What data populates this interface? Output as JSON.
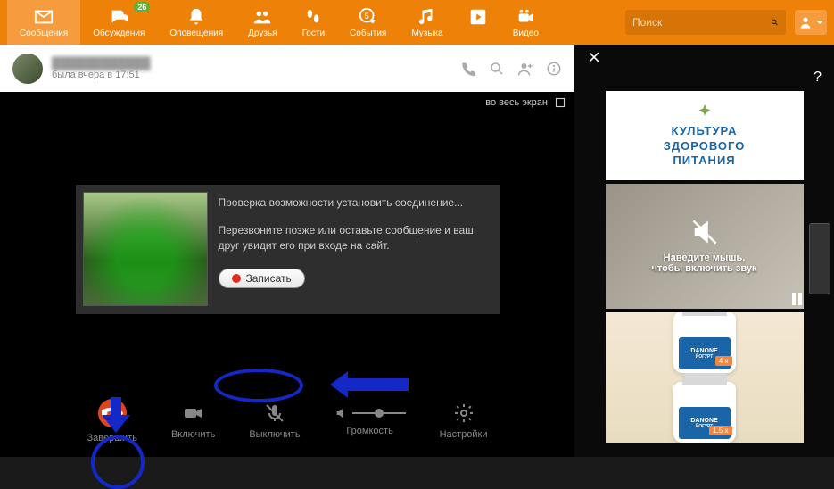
{
  "nav": {
    "messages": "Сообщения",
    "discussions": "Обсуждения",
    "discussions_badge": "26",
    "notifications": "Оповещения",
    "friends": "Друзья",
    "guests": "Гости",
    "events": "События",
    "music": "Музыка",
    "video": "Видео"
  },
  "search": {
    "placeholder": "Поиск"
  },
  "chat": {
    "name": "████████████",
    "status": "была вчера в 17:51"
  },
  "fullscreen_label": "во весь экран",
  "call": {
    "checking": "Проверка возможности установить соединение...",
    "callback": "Перезвоните позже или оставьте сообщение и ваш друг увидит его при входе на сайт.",
    "record": "Записать"
  },
  "controls": {
    "end": "Завершить",
    "video_on": "Включить",
    "mic_off": "Выключить",
    "volume": "Громкость",
    "settings": "Настройки"
  },
  "side": {
    "help": "?"
  },
  "ads": {
    "ad1_line1": "КУЛЬТУРА",
    "ad1_line2": "ЗДОРОВОГО",
    "ad1_line3": "ПИТАНИЯ",
    "ad2_line1": "Наведите мышь,",
    "ad2_line2": "чтобы включить звук",
    "jar_brand": "DANONE",
    "jar_sub": "ЙОГУРТ",
    "jar_price1": "4 x",
    "jar_price2": "1.5 x"
  }
}
